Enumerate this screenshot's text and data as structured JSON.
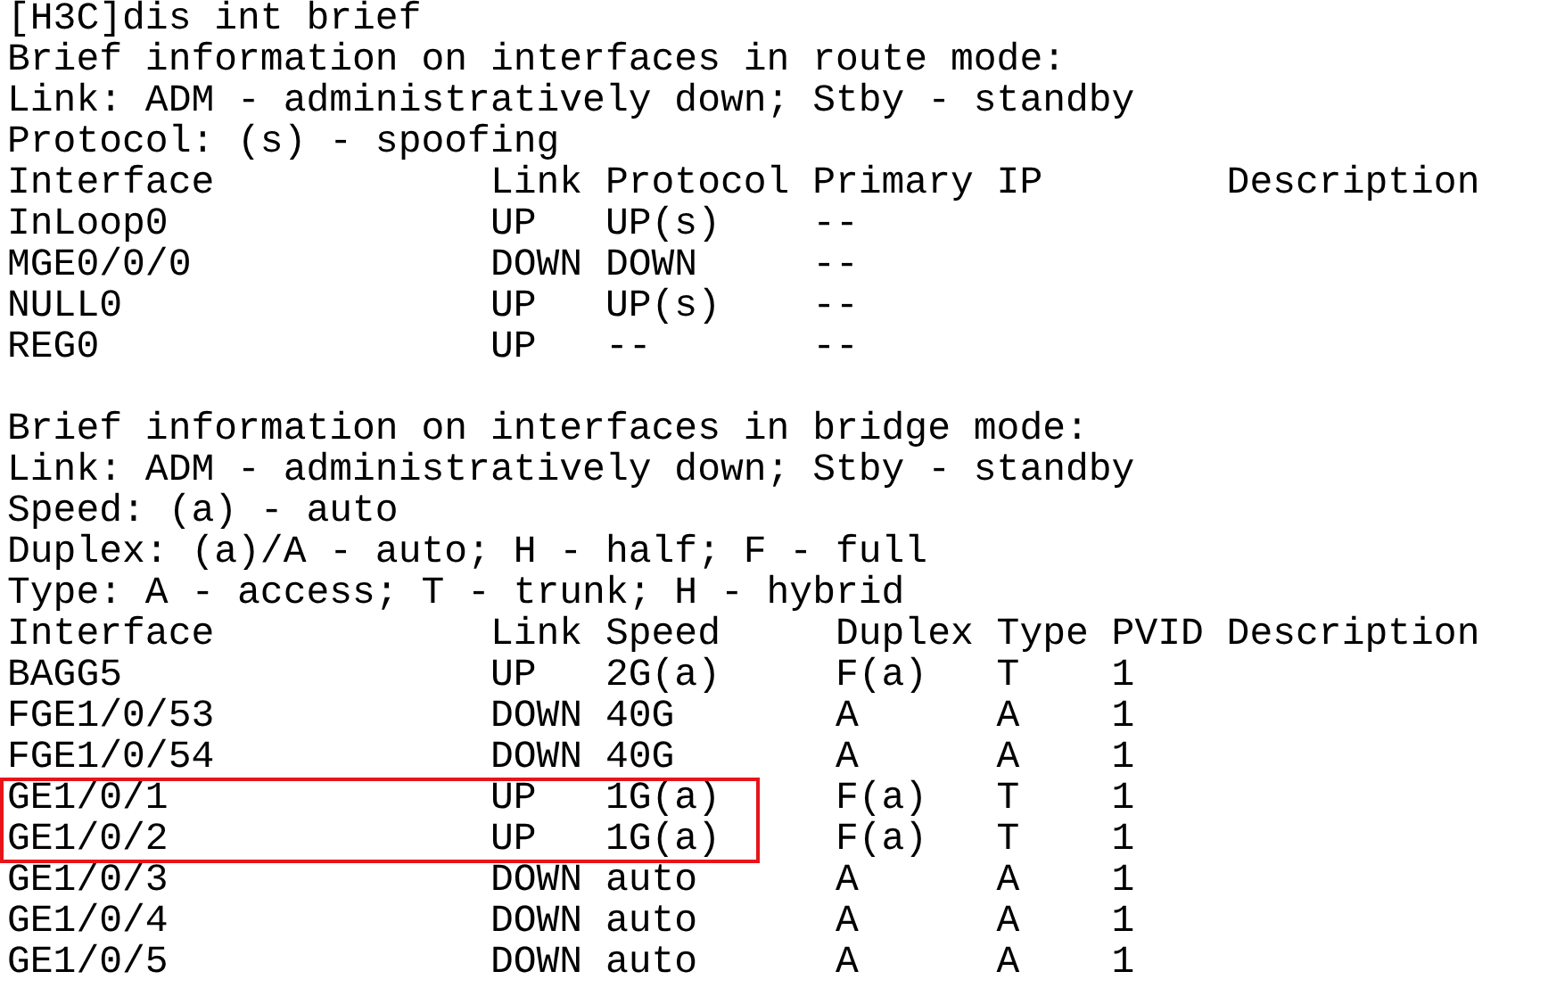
{
  "terminal": {
    "command_line": "[H3C]dis int brief",
    "sections": [
      {
        "lines": [
          {
            "text": "Brief information on interfaces in route mode:",
            "highlighted": false
          },
          {
            "text": "Link: ADM - administratively down; Stby - standby",
            "highlighted": false
          },
          {
            "text": "Protocol: (s) - spoofing",
            "highlighted": false
          },
          {
            "text": "Interface            Link Protocol Primary IP        Description",
            "highlighted": false
          },
          {
            "text": "InLoop0              UP   UP(s)    --",
            "highlighted": false
          },
          {
            "text": "MGE0/0/0             DOWN DOWN     --",
            "highlighted": false
          },
          {
            "text": "NULL0                UP   UP(s)    --",
            "highlighted": false
          },
          {
            "text": "REG0                 UP   --       --",
            "highlighted": false
          }
        ]
      },
      {
        "lines": [
          {
            "text": "Brief information on interfaces in bridge mode:",
            "highlighted": false
          },
          {
            "text": "Link: ADM - administratively down; Stby - standby",
            "highlighted": false
          },
          {
            "text": "Speed: (a) - auto",
            "highlighted": false
          },
          {
            "text": "Duplex: (a)/A - auto; H - half; F - full",
            "highlighted": false
          },
          {
            "text": "Type: A - access; T - trunk; H - hybrid",
            "highlighted": false
          },
          {
            "text": "Interface            Link Speed     Duplex Type PVID Description",
            "highlighted": false
          },
          {
            "text": "BAGG5                UP   2G(a)     F(a)   T    1",
            "highlighted": false
          },
          {
            "text": "FGE1/0/53            DOWN 40G       A      A    1",
            "highlighted": false
          },
          {
            "text": "FGE1/0/54            DOWN 40G       A      A    1",
            "highlighted": false
          },
          {
            "text": "GE1/0/1              UP   1G(a)     F(a)   T    1",
            "highlighted": true
          },
          {
            "text": "GE1/0/2              UP   1G(a)     F(a)   T    1",
            "highlighted": true
          },
          {
            "text": "GE1/0/3              DOWN auto      A      A    1",
            "highlighted": false
          },
          {
            "text": "GE1/0/4              DOWN auto      A      A    1",
            "highlighted": false
          },
          {
            "text": "GE1/0/5              DOWN auto      A      A    1",
            "highlighted": false
          }
        ]
      }
    ]
  }
}
